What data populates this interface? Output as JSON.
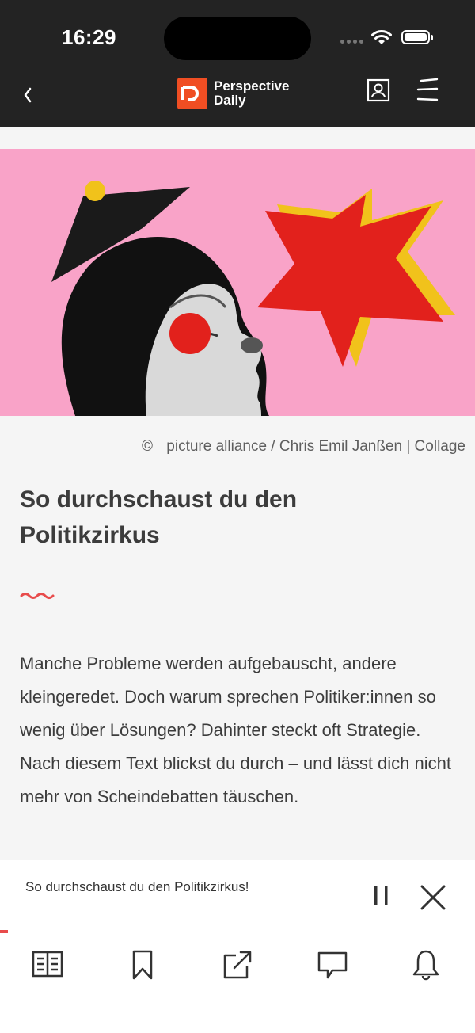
{
  "status": {
    "time": "16:29"
  },
  "nav": {
    "logo_line1": "Perspective",
    "logo_line2": "Daily",
    "icons": [
      "chevron-left-icon",
      "contact-card-icon",
      "menu-icon"
    ]
  },
  "hero": {
    "alt": "Collage: woman with mortarboard blowing into red speech bubble"
  },
  "caption": {
    "symbol": "©",
    "text": "picture alliance / Chris Emil Janßen | Collage"
  },
  "article": {
    "title": "So durchschaust du den Politikzirkus",
    "lead": "Manche Probleme werden aufgebauscht, andere kleingeredet. Doch warum sprechen Politiker:innen so wenig über Lösungen? Dahinter steckt oft Strategie. Nach diesem Text blickst du durch – und lässt dich nicht mehr von Scheindebatten täuschen."
  },
  "player": {
    "title": "So durchschaust du den Politikzirkus!",
    "progress": 0.02
  },
  "tabs": [
    "reader-icon",
    "bookmark-icon",
    "share-icon",
    "comment-icon",
    "bell-icon"
  ],
  "colors": {
    "brand": "#f04e23",
    "dark": "#232323",
    "hero_bg": "#f9a3c8",
    "accent_red": "#e84c4c"
  }
}
